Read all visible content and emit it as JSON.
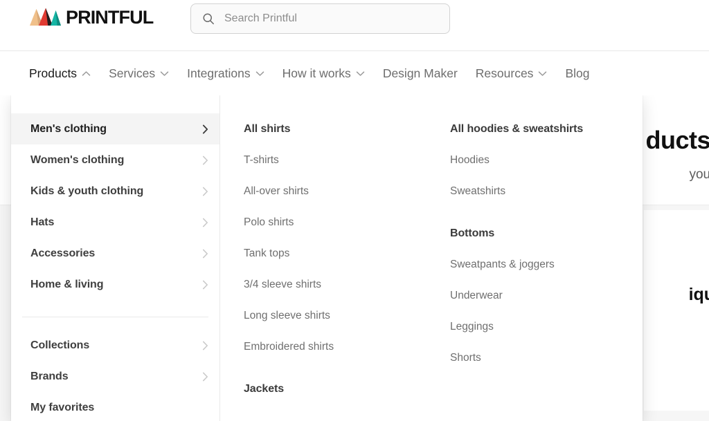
{
  "brand": {
    "name": "PRINTFUL",
    "logo_icon": "printful-mountains-logo",
    "colors": {
      "peach": "#f0c08a",
      "red": "#e03a32",
      "teal": "#15b5a4",
      "dark": "#231f20",
      "wordmark": "#111111"
    }
  },
  "search": {
    "icon": "search-icon",
    "placeholder": "Search Printful",
    "value": ""
  },
  "nav": {
    "items": [
      {
        "label": "Products",
        "caret": "chevron-up-icon",
        "active": true
      },
      {
        "label": "Services",
        "caret": "chevron-down-icon",
        "active": false
      },
      {
        "label": "Integrations",
        "caret": "chevron-down-icon",
        "active": false
      },
      {
        "label": "How it works",
        "caret": "chevron-down-icon",
        "active": false
      },
      {
        "label": "Design Maker",
        "caret": "",
        "active": false
      },
      {
        "label": "Resources",
        "caret": "chevron-down-icon",
        "active": false
      },
      {
        "label": "Blog",
        "caret": "",
        "active": false
      }
    ]
  },
  "mega_menu": {
    "categories": [
      {
        "label": "Men's clothing",
        "arrow": "chevron-right-icon",
        "active": true
      },
      {
        "label": "Women's clothing",
        "arrow": "chevron-right-icon",
        "active": false
      },
      {
        "label": "Kids & youth clothing",
        "arrow": "chevron-right-icon",
        "active": false
      },
      {
        "label": "Hats",
        "arrow": "chevron-right-icon",
        "active": false
      },
      {
        "label": "Accessories",
        "arrow": "chevron-right-icon",
        "active": false
      },
      {
        "label": "Home & living",
        "arrow": "chevron-right-icon",
        "active": false
      }
    ],
    "secondary": [
      {
        "label": "Collections",
        "arrow": "chevron-right-icon"
      },
      {
        "label": "Brands",
        "arrow": "chevron-right-icon"
      },
      {
        "label": "My favorites",
        "arrow": ""
      }
    ],
    "column_shirts": {
      "heading": "All shirts",
      "links": [
        "T-shirts",
        "All-over shirts",
        "Polo shirts",
        "Tank tops",
        "3/4 sleeve shirts",
        "Long sleeve shirts",
        "Embroidered shirts"
      ],
      "heading2": "Jackets"
    },
    "column_hoodies": {
      "heading": "All hoodies & sweatshirts",
      "links": [
        "Hoodies",
        "Sweatshirts"
      ],
      "heading2": "Bottoms",
      "links2": [
        "Sweatpants & joggers",
        "Underwear",
        "Leggings",
        "Shorts"
      ]
    }
  },
  "background_page": {
    "title_fragment": "ducts",
    "subtitle_fragment": "your ow",
    "card_title_fragment": "ique"
  }
}
